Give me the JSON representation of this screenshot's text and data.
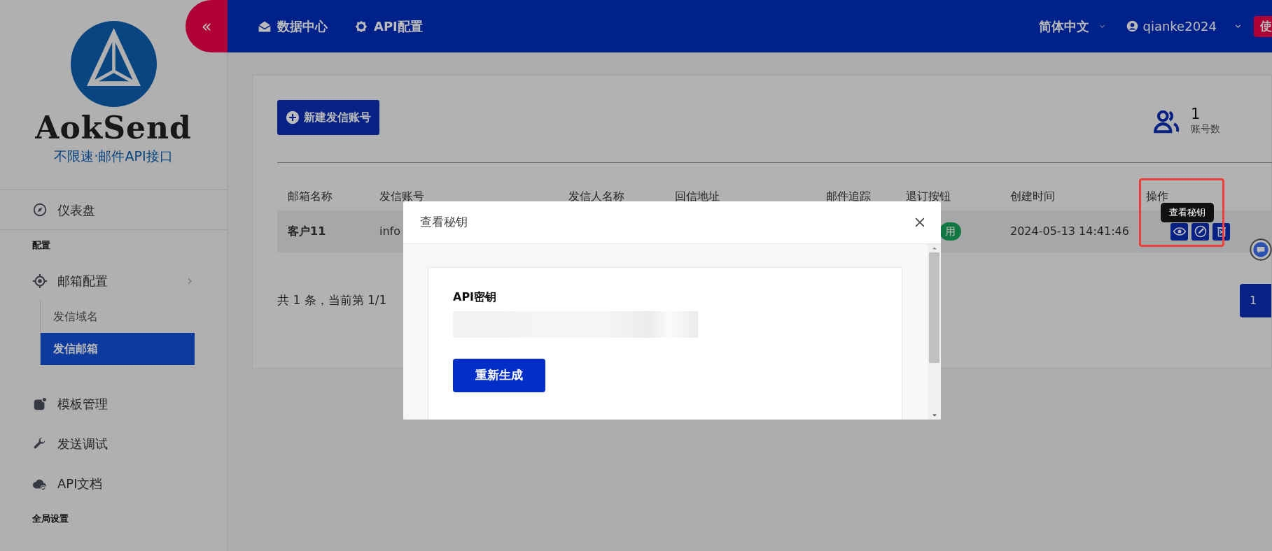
{
  "sidebar": {
    "collapse_button": "«",
    "logo": {
      "name": "AokSend",
      "tagline": "不限速·邮件API接口"
    },
    "nav": [
      {
        "kind": "item",
        "label": "仪表盘",
        "selected": false
      },
      {
        "kind": "heading",
        "label": "配置"
      },
      {
        "kind": "item",
        "label": "邮箱配置",
        "selected": false,
        "expanded": true,
        "children": [
          {
            "label": "发信域名",
            "selected": false
          },
          {
            "label": "发信邮箱",
            "selected": true
          }
        ]
      },
      {
        "kind": "item",
        "label": "模板管理",
        "selected": false
      },
      {
        "kind": "item",
        "label": "发送调试",
        "selected": false
      },
      {
        "kind": "item",
        "label": "API文档",
        "selected": false
      },
      {
        "kind": "heading",
        "label": "全局设置"
      }
    ]
  },
  "header": {
    "nav": [
      {
        "label": "数据中心"
      },
      {
        "label": "API配置"
      }
    ],
    "language": "简体中文",
    "user": "qianke2024",
    "edge_button": "使"
  },
  "content": {
    "new_button": "新建发信账号",
    "stat": {
      "value": "1",
      "label": "账号数"
    },
    "table": {
      "columns": [
        "邮箱名称",
        "发信账号",
        "发信人名称",
        "回信地址",
        "邮件追踪",
        "退订按钮",
        "创建时间",
        "操作"
      ],
      "rows": [
        {
          "name": "客户11",
          "account": "info",
          "unsubscribe": "用",
          "created": "2024-05-13 14:41:46"
        }
      ]
    },
    "tooltip": "查看秘钥",
    "pagination": {
      "summary": "共 1 条，当前第 1/1",
      "pages": [
        {
          "label": "1",
          "selected": true
        }
      ]
    }
  },
  "modal": {
    "title": "查看秘钥",
    "field_label": "API密钥",
    "button": "重新生成"
  }
}
